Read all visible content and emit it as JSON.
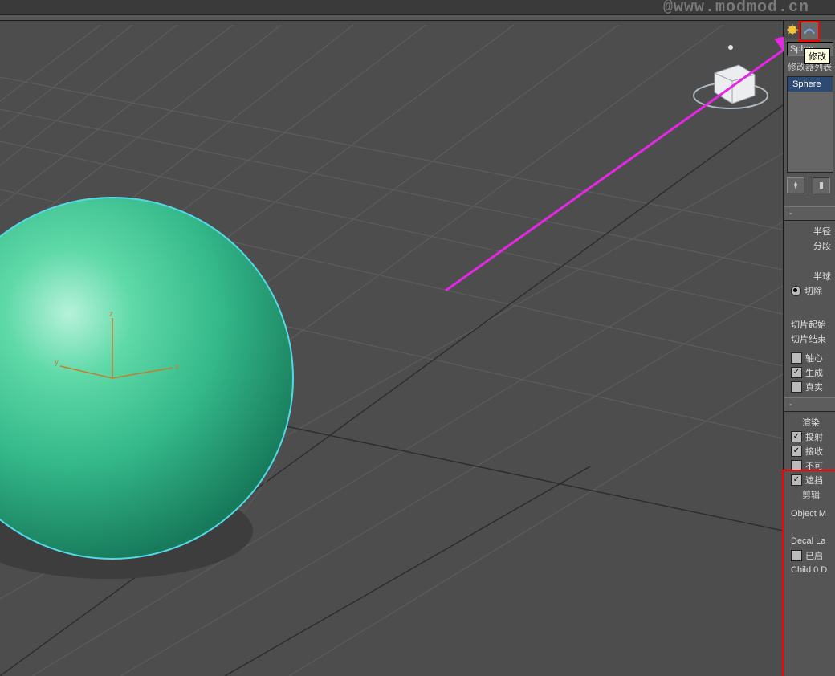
{
  "watermark": "@www.modmod.cn",
  "tooltip": "修改",
  "object_name": "Spher",
  "modifier_list_label": "修改器列表",
  "modifier_stack_item": "Sphere",
  "params": {
    "radius_label": "半径",
    "segments_label": "分段",
    "hemisphere_label": "半球",
    "chop_label": "切除",
    "slice_from_label": "切片起始",
    "slice_to_label": "切片结束",
    "pivot_label": "轴心",
    "gen_mapping_label": "生成",
    "real_world_label": "真实"
  },
  "render": {
    "title": "渲染",
    "cast_shadows_label": "投射",
    "receive_shadows_label": "接收",
    "invisible_label": "不可",
    "occlusion_label": "遮挡",
    "clip_label": "剪辑",
    "object_m_label": "Object M",
    "decal_label": "Decal La",
    "enabled_label": "已启",
    "child_label": "Child 0 D"
  },
  "checks": {
    "pivot": false,
    "gen_mapping": true,
    "real_world": false,
    "cast_shadows": true,
    "receive_shadows": true,
    "invisible": false,
    "occlusion": true,
    "enabled": false
  }
}
